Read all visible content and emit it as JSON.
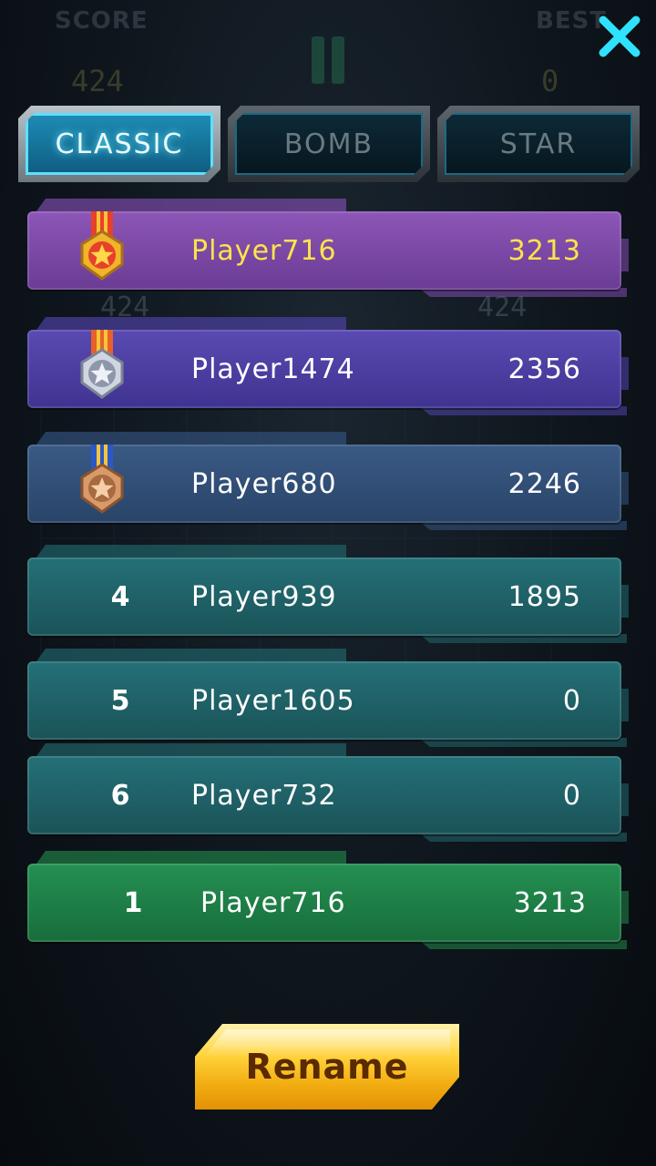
{
  "background": {
    "score_label": "SCORE",
    "best_label": "BEST",
    "score_value": "424",
    "best_value": "0",
    "ghost_value_left": "424",
    "ghost_value_right": "424"
  },
  "close_icon": "close-x-icon",
  "tabs": [
    {
      "label": "CLASSIC",
      "active": true
    },
    {
      "label": "BOMB",
      "active": false
    },
    {
      "label": "STAR",
      "active": false
    }
  ],
  "leaderboard": [
    {
      "rank": "1",
      "medal": "gold-medal-icon",
      "name": "Player716",
      "score": "3213"
    },
    {
      "rank": "2",
      "medal": "silver-medal-icon",
      "name": "Player1474",
      "score": "2356"
    },
    {
      "rank": "3",
      "medal": "bronze-medal-icon",
      "name": "Player680",
      "score": "2246"
    },
    {
      "rank": "4",
      "name": "Player939",
      "score": "1895"
    },
    {
      "rank": "5",
      "name": "Player1605",
      "score": "0"
    },
    {
      "rank": "6",
      "name": "Player732",
      "score": "0"
    }
  ],
  "my_entry": {
    "rank": "1",
    "name": "Player716",
    "score": "3213"
  },
  "rename_button": {
    "label": "Rename"
  },
  "colors": {
    "accent_cyan": "#5de0ff",
    "gold_text": "#ffe34a",
    "rank1_row": "#7a4aa8",
    "rank2_row": "#4d40a3",
    "rank3_row": "#32507a",
    "other_row": "#1f6268",
    "my_row": "#1f7e46",
    "rename_button": "#ffd23a"
  }
}
